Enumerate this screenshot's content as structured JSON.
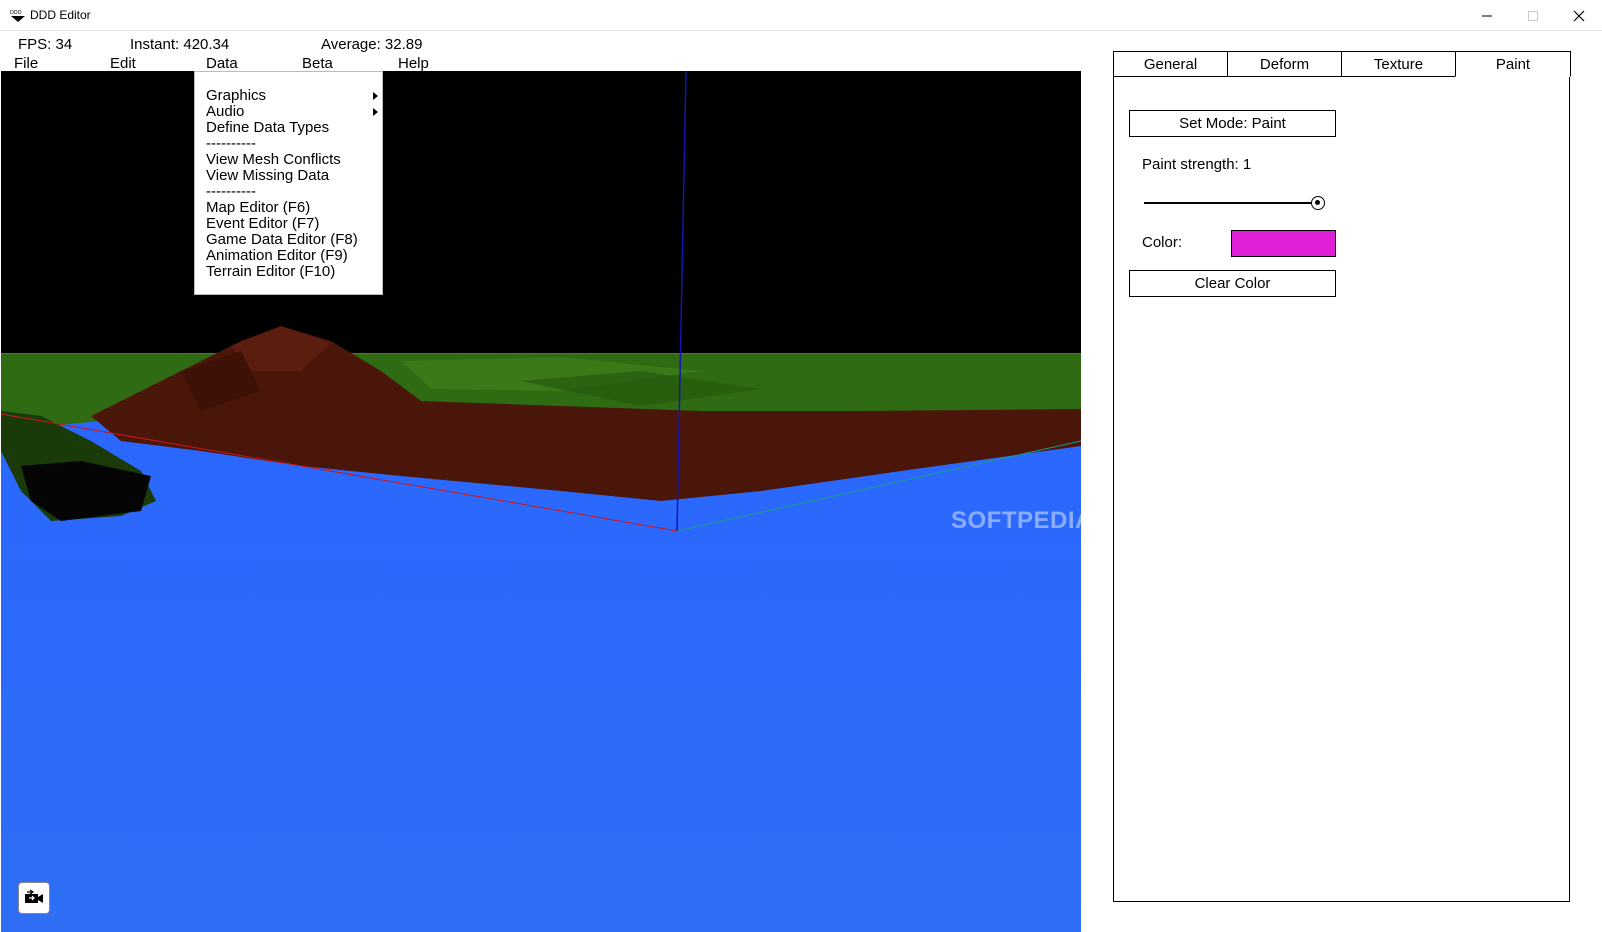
{
  "window": {
    "title": "DDD Editor",
    "icon_text": "DDD"
  },
  "stats": {
    "fps": "FPS: 34",
    "instant": "Instant: 420.34",
    "average": "Average: 32.89"
  },
  "menubar": {
    "file": "File",
    "edit": "Edit",
    "data": "Data",
    "beta": "Beta",
    "help": "Help"
  },
  "data_menu": {
    "items": [
      "Graphics",
      "Audio",
      "Define Data Types",
      "----------",
      "View Mesh Conflicts",
      "View Missing Data",
      "----------",
      "Map Editor (F6)",
      "Event Editor (F7)",
      "Game Data Editor (F8)",
      "Animation Editor (F9)",
      "Terrain Editor (F10)"
    ],
    "submenu_items": [
      "Graphics",
      "Audio"
    ]
  },
  "viewport": {
    "watermark": "SOFTPEDIA",
    "icon": "camera-icon"
  },
  "panel": {
    "tabs": [
      "General",
      "Deform",
      "Texture",
      "Paint"
    ],
    "active_tab": "Paint",
    "set_mode_label": "Set Mode: Paint",
    "paint_strength_label": "Paint strength: 1",
    "paint_strength_value": 1,
    "color_label": "Color:",
    "color_value": "#e020d8",
    "clear_color_label": "Clear Color"
  },
  "colors": {
    "sky": "#000000",
    "water": "#2f6cff",
    "grass": "#2f6b12",
    "mountain": "#4a160a"
  }
}
